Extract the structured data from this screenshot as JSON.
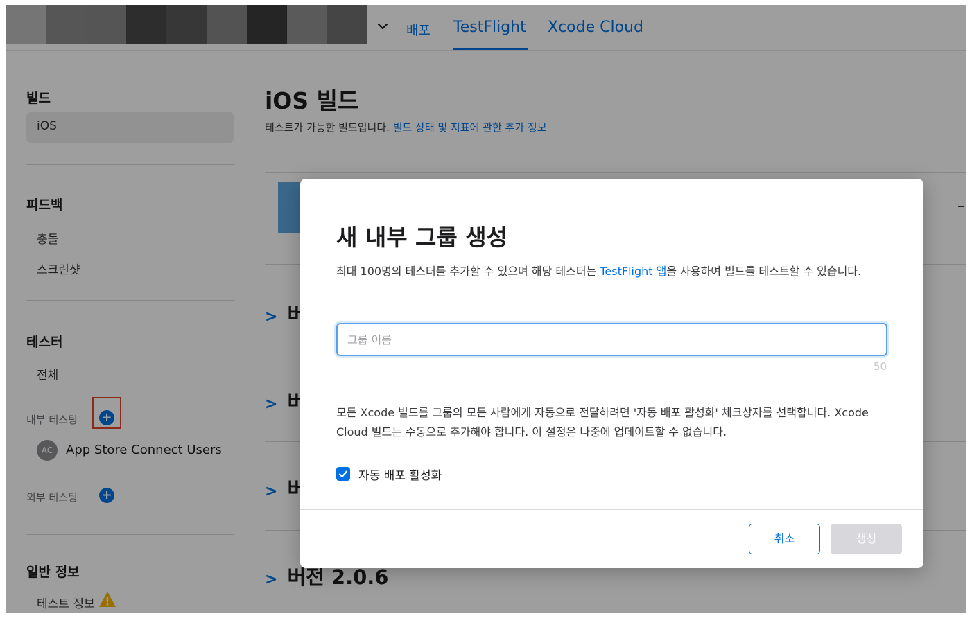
{
  "nav": {
    "deploy": "배포",
    "testflight": "TestFlight",
    "xcode_cloud": "Xcode Cloud",
    "redacted_colors": [
      "#bdbdbd",
      "#8c8c8c",
      "#8a8a8a",
      "#4a4a4a",
      "#5a5a5a",
      "#868686",
      "#3c3c3c",
      "#929292",
      "#707070"
    ]
  },
  "sidebar": {
    "builds_title": "빌드",
    "builds_ios": "iOS",
    "feedback_title": "피드백",
    "feedback_crash": "충돌",
    "feedback_screenshot": "스크린샷",
    "testers_title": "테스터",
    "testers_all": "전체",
    "internal_testing": "내부 테스팅",
    "internal_group_avatar": "AC",
    "internal_group": "App Store Connect Users",
    "external_testing": "외부 테스팅",
    "general_title": "일반 정보",
    "test_info": "테스트 정보"
  },
  "main": {
    "title": "iOS 빌드",
    "subtitle": "테스트가 가능한 빌드입니다.",
    "subtitle_link": "빌드 상태 및 지표에 관한 추가 정보",
    "version_partial": "버",
    "version_last": "버전 2.0.6"
  },
  "modal": {
    "title": "새 내부 그룹 생성",
    "desc_before": "최대 100명의 테스터를 추가할 수 있으며 해당 테스터는 ",
    "desc_link": "TestFlight 앱",
    "desc_after": "을 사용하여 빌드를 테스트할 수 있습니다.",
    "input_placeholder": "그룹 이름",
    "input_value": "",
    "char_count": "50",
    "note": "모든 Xcode 빌드를 그룹의 모든 사람에게 자동으로 전달하려면 '자동 배포 활성화' 체크상자를 선택합니다. Xcode Cloud 빌드는 수동으로 추가해야 합니다. 이 설정은 나중에 업데이트할 수 없습니다.",
    "checkbox_label": "자동 배포 활성화",
    "checkbox_checked": true,
    "cancel_label": "취소",
    "create_label": "생성"
  },
  "colors": {
    "accent": "#0071e3",
    "highlight": "#e0452c",
    "warning": "#f5b400"
  }
}
